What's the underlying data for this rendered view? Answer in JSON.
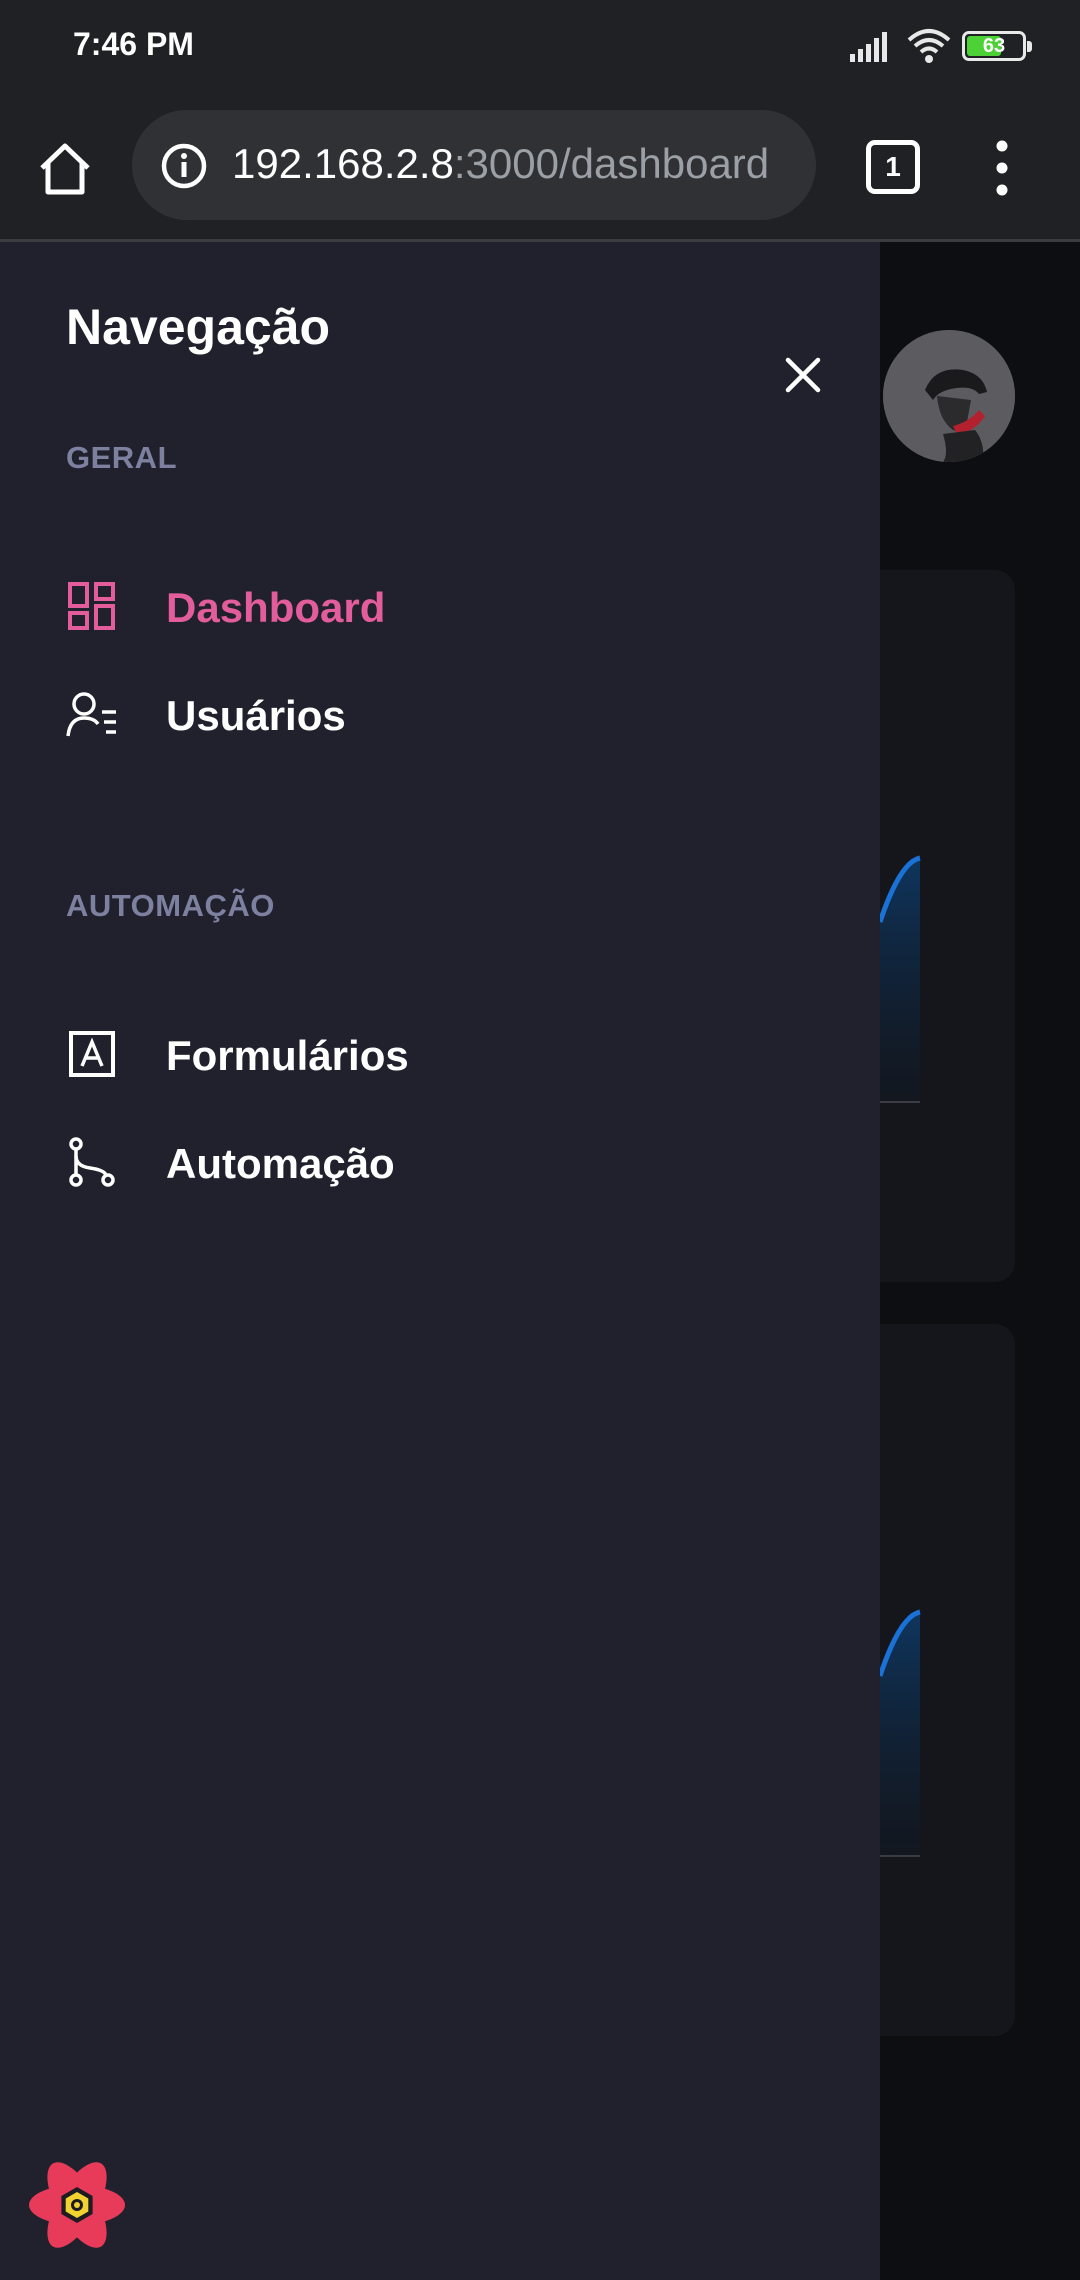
{
  "status_bar": {
    "time": "7:46 PM",
    "battery_percent": "63",
    "battery_level": 0.63,
    "icons": [
      "signal-icon",
      "wifi-icon",
      "battery-icon"
    ]
  },
  "browser": {
    "url_host": "192.168.2.8",
    "url_rest": ":3000/dashboard",
    "tab_count": "1",
    "icons": [
      "home-icon",
      "info-icon",
      "tabs-icon",
      "more-vert-icon"
    ]
  },
  "drawer": {
    "title": "Navegação",
    "sections": [
      {
        "label": "GERAL",
        "items": [
          {
            "label": "Dashboard",
            "icon": "dashboard-icon",
            "active": true
          },
          {
            "label": "Usuários",
            "icon": "users-list-icon",
            "active": false
          }
        ]
      },
      {
        "label": "AUTOMAÇÃO",
        "items": [
          {
            "label": "Formulários",
            "icon": "form-icon",
            "active": false
          },
          {
            "label": "Automação",
            "icon": "flow-icon",
            "active": false
          }
        ]
      }
    ]
  },
  "colors": {
    "accent": "#e35d9d",
    "drawer_bg": "#20212c",
    "section_label": "#7e80a0",
    "browser_bg": "#202124"
  }
}
